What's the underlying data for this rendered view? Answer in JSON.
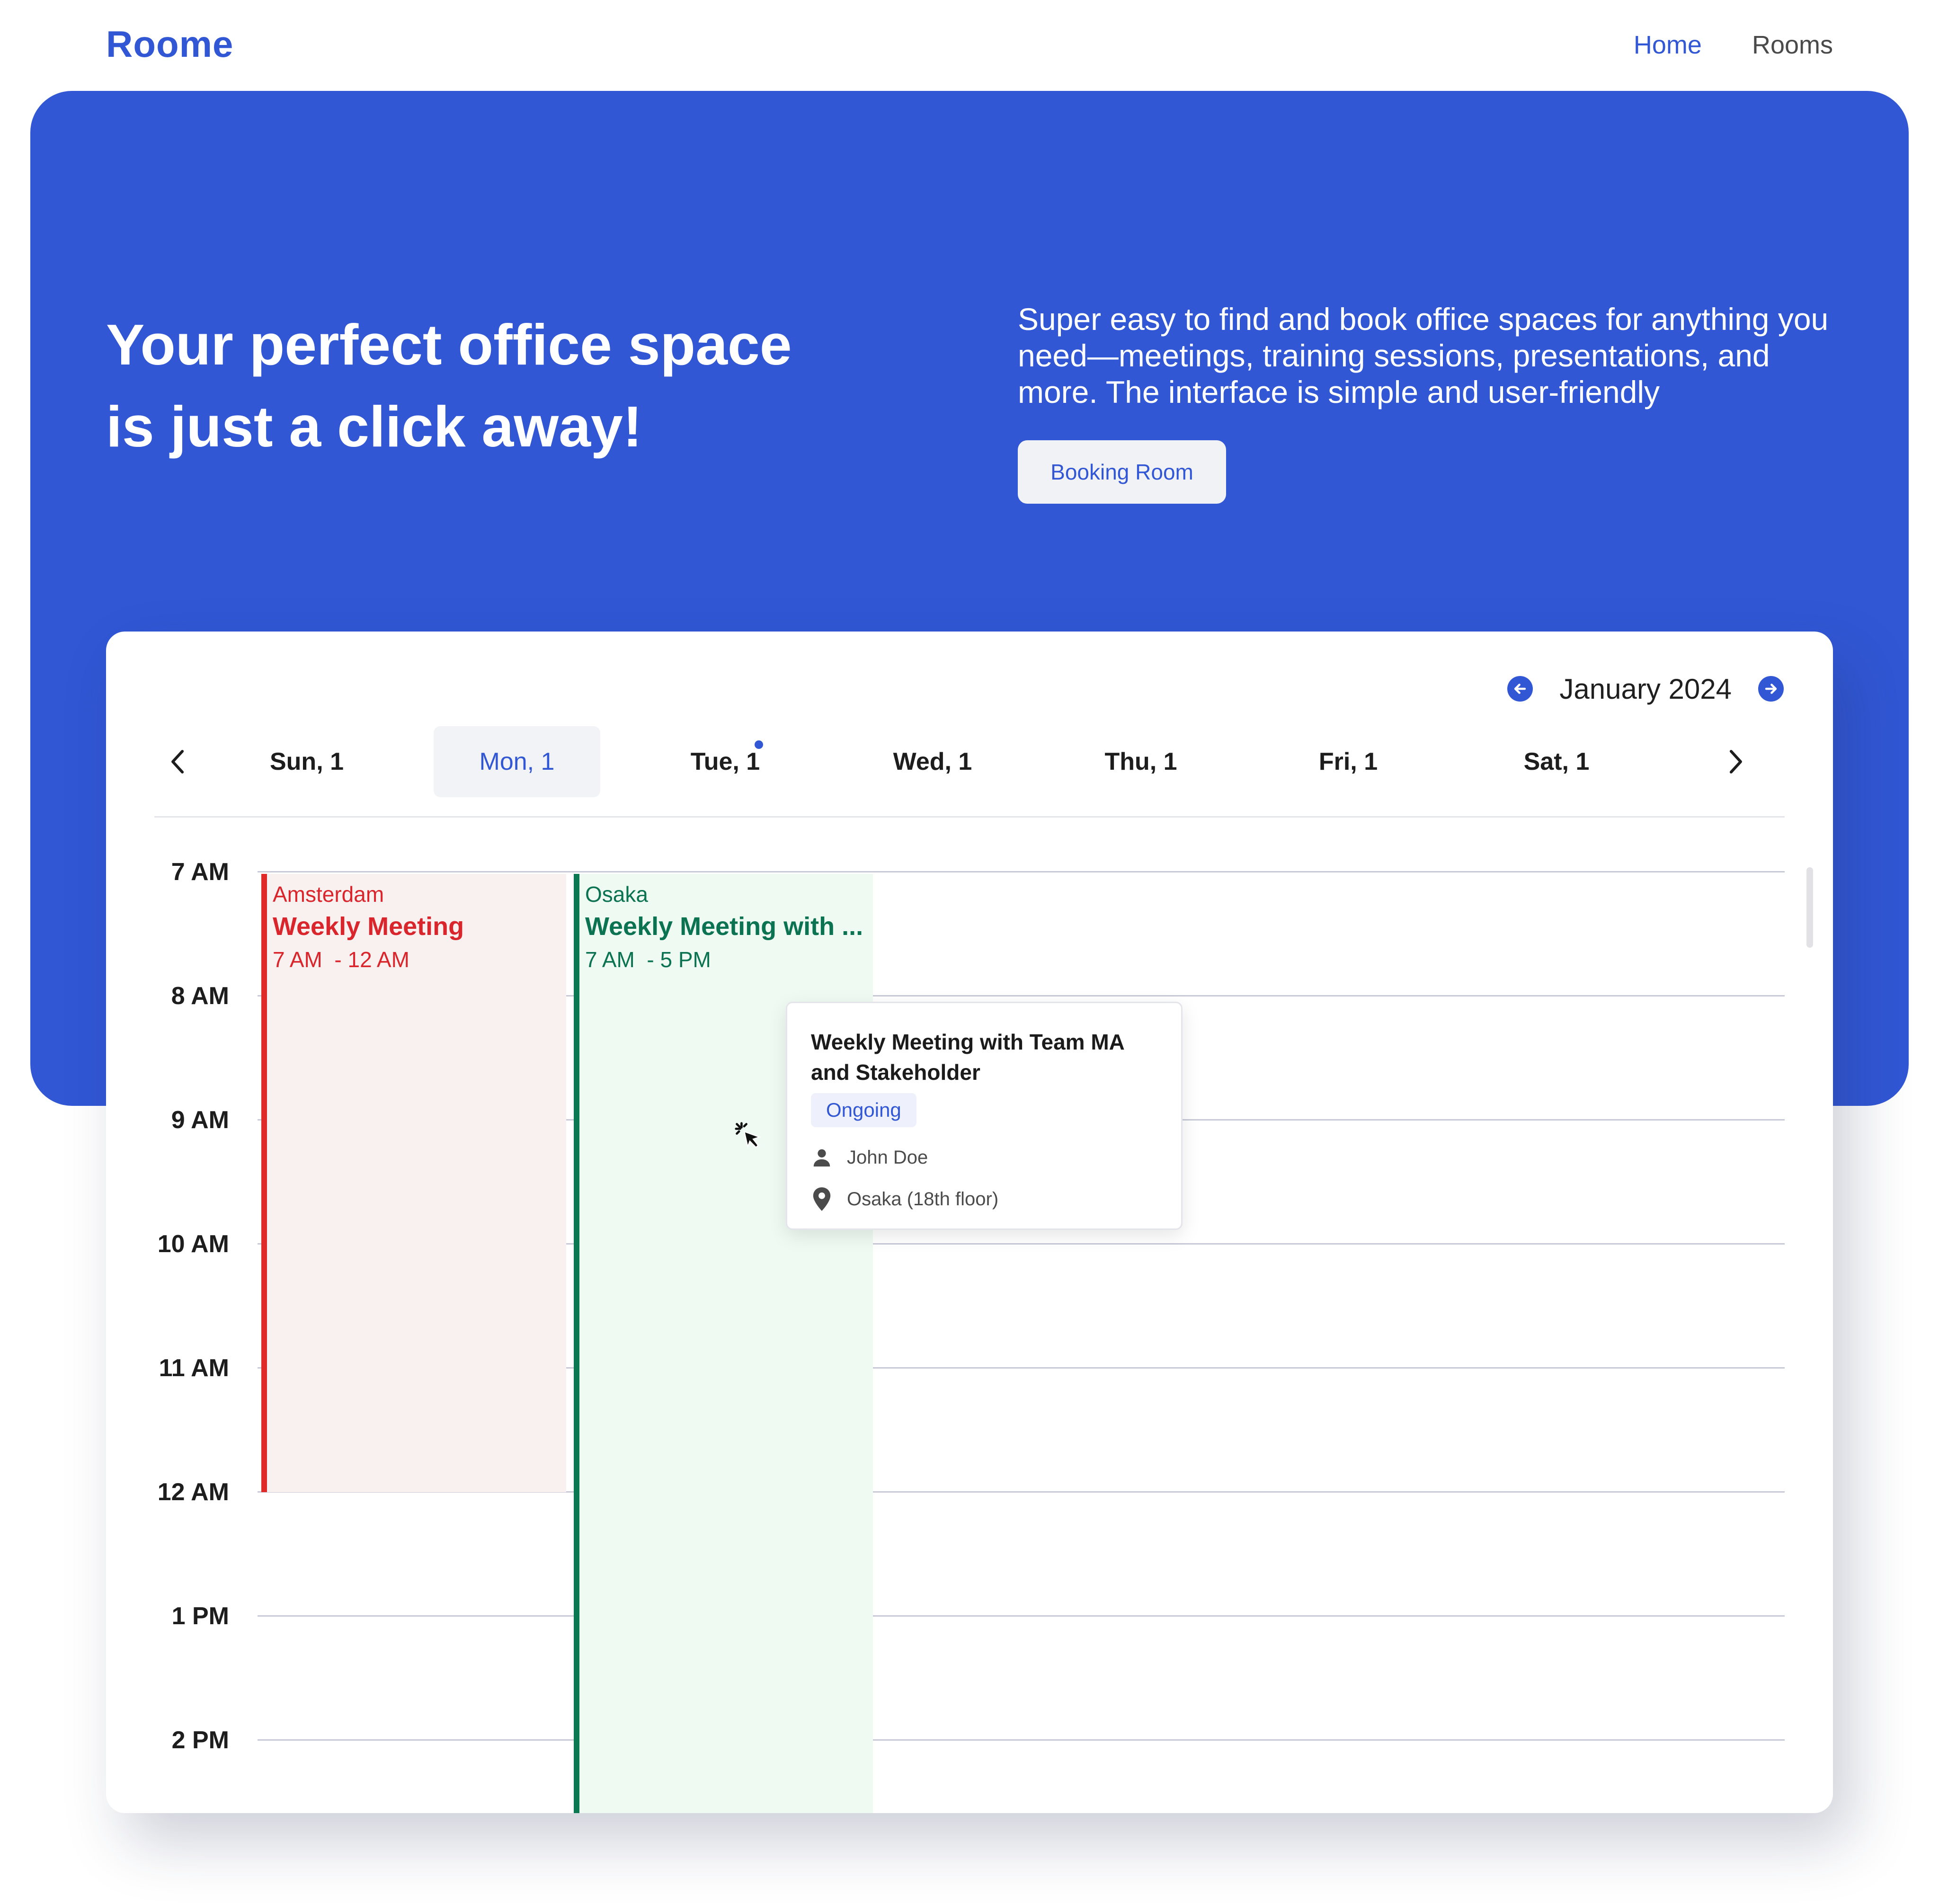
{
  "brand": {
    "name": "Roome",
    "color": "#3157d5"
  },
  "nav": {
    "items": [
      {
        "label": "Home",
        "active": true
      },
      {
        "label": "Rooms",
        "active": false
      }
    ]
  },
  "hero": {
    "title": "Your perfect office space is just a click away!",
    "description": "Super easy to find and book office spaces for anything you need—meetings, training sessions, presentations, and more. The interface is simple and user-friendly",
    "cta_label": "Booking Room"
  },
  "calendar": {
    "month_label": "January 2024",
    "prev_month_icon": "arrow-left-circle-icon",
    "next_month_icon": "arrow-right-circle-icon",
    "days": [
      {
        "label": "Sun, 1",
        "selected": false,
        "has_dot": false
      },
      {
        "label": "Mon, 1",
        "selected": true,
        "has_dot": false
      },
      {
        "label": "Tue, 1",
        "selected": false,
        "has_dot": true
      },
      {
        "label": "Wed, 1",
        "selected": false,
        "has_dot": false
      },
      {
        "label": "Thu, 1",
        "selected": false,
        "has_dot": false
      },
      {
        "label": "Fri, 1",
        "selected": false,
        "has_dot": false
      },
      {
        "label": "Sat, 1",
        "selected": false,
        "has_dot": false
      }
    ],
    "hours": [
      "7 AM",
      "8 AM",
      "9 AM",
      "10 AM",
      "11 AM",
      "12 AM",
      "1 PM",
      "2 PM"
    ],
    "events": [
      {
        "location": "Amsterdam",
        "title": "Weekly Meeting",
        "time": "7 AM  - 12 AM",
        "color": "#e02929",
        "background": "#f9f0f0"
      },
      {
        "location": "Osaka",
        "title": "Weekly Meeting with ...",
        "time": "7 AM  - 5 PM",
        "color": "#0b7a52",
        "background": "#eefaf2"
      }
    ],
    "popover": {
      "title": "Weekly Meeting with Team MA and Stakeholder",
      "status": "Ongoing",
      "organizer": "John Doe",
      "location": "Osaka (18th floor)",
      "organizer_icon": "person-icon",
      "location_icon": "map-pin-icon"
    }
  }
}
